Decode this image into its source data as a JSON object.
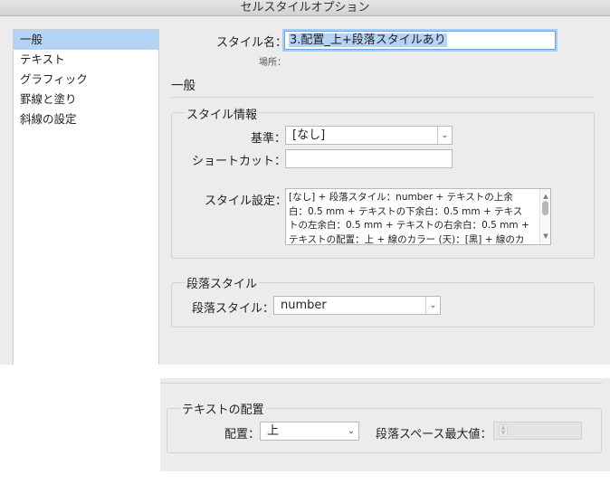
{
  "window": {
    "title": "セルスタイルオプション"
  },
  "sidebar": {
    "items": [
      {
        "label": "一般",
        "selected": true
      },
      {
        "label": "テキスト"
      },
      {
        "label": "グラフィック"
      },
      {
        "label": "罫線と塗り"
      },
      {
        "label": "斜線の設定"
      }
    ]
  },
  "form": {
    "style_name_label": "スタイル名：",
    "style_name_value": "3.配置_上+段落スタイルあり",
    "location_label": "場所："
  },
  "general_section": {
    "title": "一般"
  },
  "style_info": {
    "title": "スタイル情報",
    "base_label": "基準：",
    "base_value": "[なし]",
    "shortcut_label": "ショートカット：",
    "shortcut_value": "",
    "settings_label": "スタイル設定：",
    "settings_text": "[なし] + 段落スタイル：number + テキストの上余白：0.5 mm + テキストの下余白：0.5 mm + テキストの左余白：0.5 mm + テキストの右余白：0.5 mm + テキストの配置：上 + 線のカラー (天)：[黒] + 線のカラー (地)：[黒] + 線のカラー"
  },
  "paragraph_style": {
    "title": "段落スタイル",
    "label": "段落スタイル：",
    "value": "number"
  },
  "text_alignment": {
    "title": "テキストの配置",
    "align_label": "配置：",
    "align_value": "上",
    "max_spacing_label": "段落スペース最大値：",
    "max_spacing_value": ""
  }
}
